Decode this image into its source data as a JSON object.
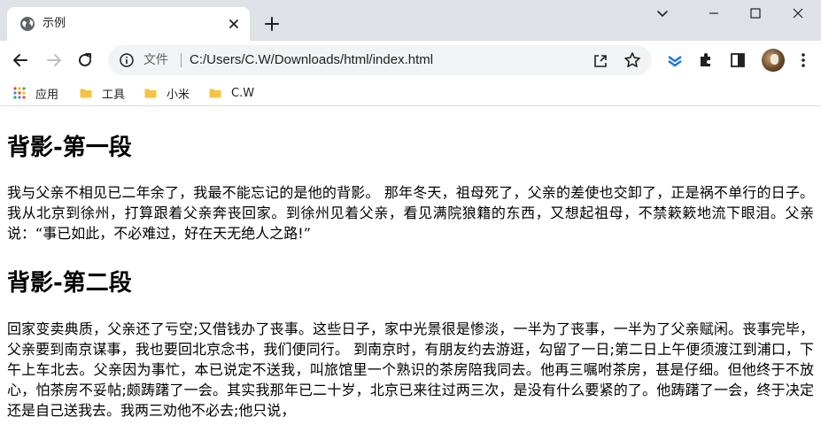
{
  "browser": {
    "tab": {
      "title": "示例"
    },
    "omnibox": {
      "scheme_label": "文件",
      "url": "C:/Users/C.W/Downloads/html/index.html"
    },
    "bookmarks": [
      {
        "label": "应用",
        "icon": "apps-grid-icon"
      },
      {
        "label": "工具",
        "icon": "folder-icon"
      },
      {
        "label": "小米",
        "icon": "folder-icon"
      },
      {
        "label": "C.W",
        "icon": "folder-icon"
      }
    ]
  },
  "page": {
    "sections": [
      {
        "heading": "背影-第一段",
        "text": "我与父亲不相见已二年余了，我最不能忘记的是他的背影。 那年冬天，祖母死了，父亲的差使也交卸了，正是祸不单行的日子。我从北京到徐州，打算跟着父亲奔丧回家。到徐州见着父亲，看见满院狼籍的东西，又想起祖母，不禁簌簌地流下眼泪。父亲说：“事已如此，不必难过，好在天无绝人之路!”"
      },
      {
        "heading": "背影-第二段",
        "text": "回家变卖典质，父亲还了亏空;又借钱办了丧事。这些日子，家中光景很是惨淡，一半为了丧事，一半为了父亲赋闲。丧事完毕，父亲要到南京谋事，我也要回北京念书，我们便同行。 到南京时，有朋友约去游逛，勾留了一日;第二日上午便须渡江到浦口，下午上车北去。父亲因为事忙，本已说定不送我，叫旅馆里一个熟识的茶房陪我同去。他再三嘱咐茶房，甚是仔细。但他终于不放心，怕茶房不妥帖;颇踌躇了一会。其实我那年已二十岁，北京已来往过两三次，是没有什么要紧的了。他踌躇了一会，终于决定还是自己送我去。我两三劝他不必去;他只说，"
      }
    ]
  },
  "colors": {
    "titlebar_bg": "#dee1e6",
    "omnibox_bg": "#f1f3f4",
    "folder_yellow": "#f4c542",
    "extension_blue": "#1a73e8"
  }
}
